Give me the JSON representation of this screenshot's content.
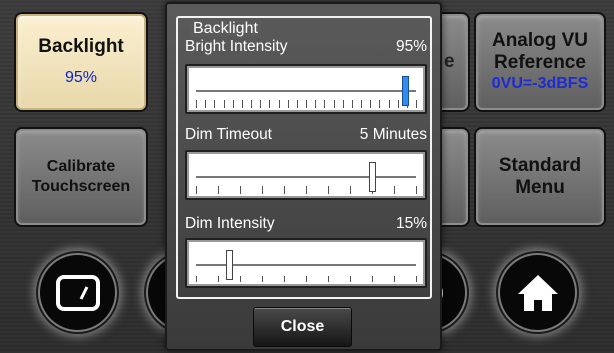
{
  "tiles": {
    "backlight": {
      "title": "Backlight",
      "value": "95%"
    },
    "calibrate": {
      "line1": "Calibrate",
      "line2": "Touchscreen"
    },
    "analog_vu": {
      "line1": "Analog VU",
      "line2": "Reference",
      "value": "0VU=-3dBFS"
    },
    "standard": {
      "line1": "Standard",
      "line2": "Menu"
    },
    "hidden_glyph": "e"
  },
  "dialog": {
    "group_title": "Backlight",
    "sliders": [
      {
        "label": "Bright Intensity",
        "value": "95%",
        "fraction": 0.95
      },
      {
        "label": "Dim Timeout",
        "value": "5 Minutes",
        "fraction": 0.8
      },
      {
        "label": "Dim Intensity",
        "value": "15%",
        "fraction": 0.15
      }
    ],
    "close_label": "Close"
  },
  "icons": [
    "screen-icon",
    "settings-icon",
    "home-icon"
  ]
}
